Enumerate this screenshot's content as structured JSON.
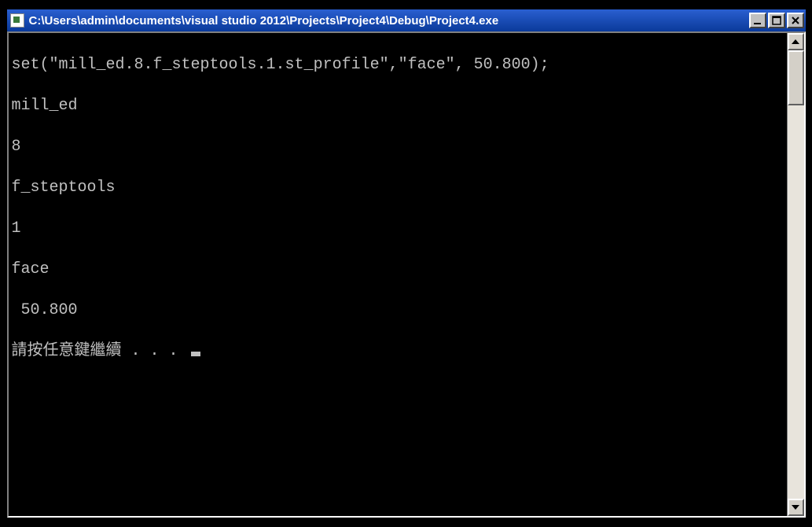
{
  "window": {
    "title": "C:\\Users\\admin\\documents\\visual studio 2012\\Projects\\Project4\\Debug\\Project4.exe"
  },
  "console": {
    "lines": [
      "set(\"mill_ed.8.f_steptools.1.st_profile\",\"face\", 50.800);",
      "mill_ed",
      "8",
      "f_steptools",
      "1",
      "face",
      " 50.800"
    ],
    "prompt": "請按任意鍵繼續 . . . "
  }
}
